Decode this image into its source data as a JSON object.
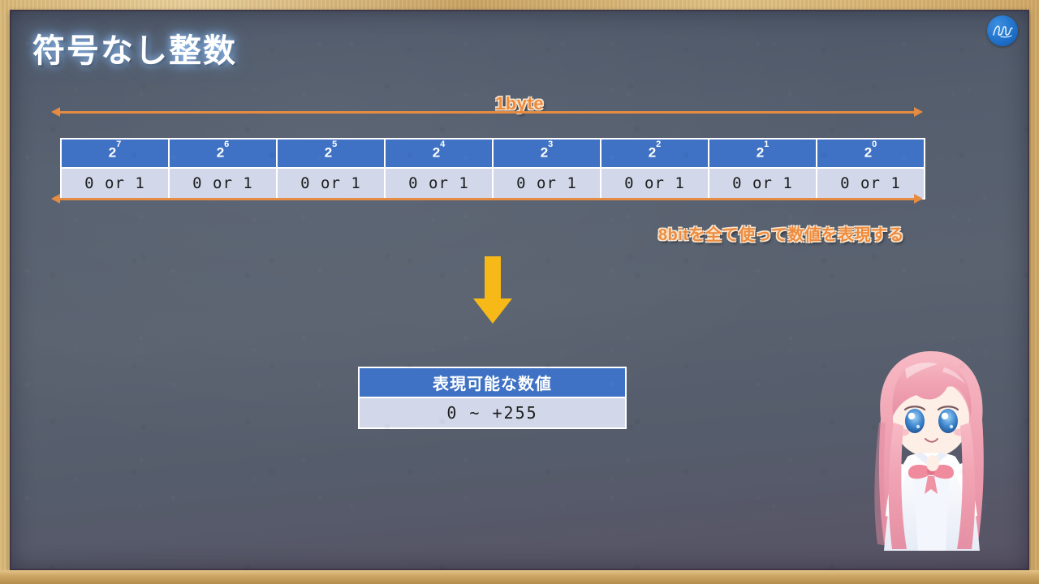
{
  "slide": {
    "title": "符号なし整数",
    "byte_label": "1byte",
    "note": "8bitを全て使って数値を表現する",
    "logo": "signature-logo",
    "down_arrow": "down-arrow-icon",
    "character": "chibi-girl-illustration"
  },
  "bit_table": {
    "headers": [
      {
        "base": "2",
        "exp": "7"
      },
      {
        "base": "2",
        "exp": "6"
      },
      {
        "base": "2",
        "exp": "5"
      },
      {
        "base": "2",
        "exp": "4"
      },
      {
        "base": "2",
        "exp": "3"
      },
      {
        "base": "2",
        "exp": "2"
      },
      {
        "base": "2",
        "exp": "1"
      },
      {
        "base": "2",
        "exp": "0"
      }
    ],
    "cells": [
      "0 or 1",
      "0 or 1",
      "0 or 1",
      "0 or 1",
      "0 or 1",
      "0 or 1",
      "0 or 1",
      "0 or 1"
    ]
  },
  "result_table": {
    "header": "表現可能な数値",
    "value": "0 ~ +255"
  },
  "colors": {
    "board": "#545e6d",
    "frame": "#d9b878",
    "table_header": "#3f72c4",
    "table_cell": "#d2d8ea",
    "accent_orange": "#ef8b3c",
    "arrow_yellow": "#f7b917",
    "title_text": "#ffffff"
  }
}
